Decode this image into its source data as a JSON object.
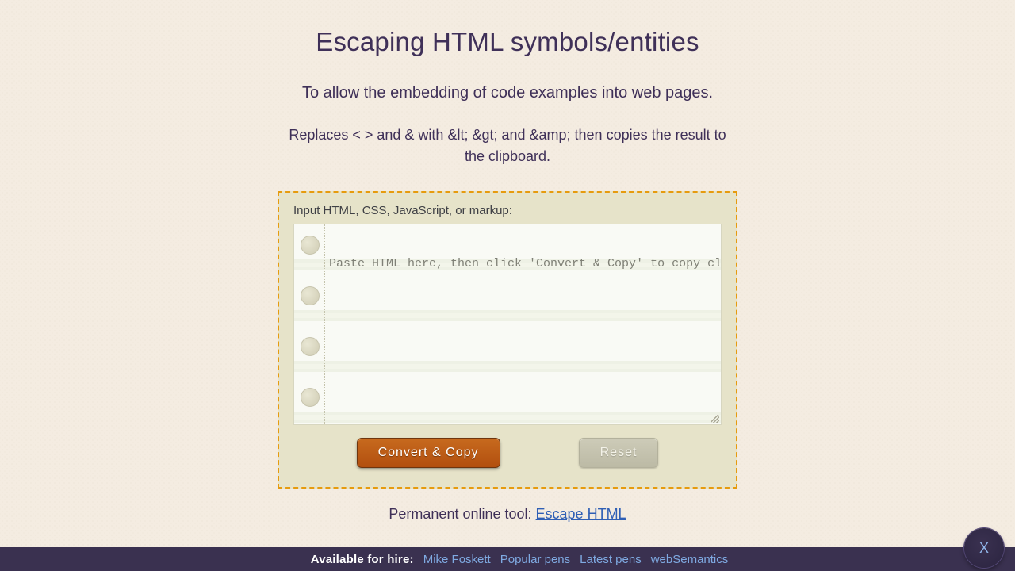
{
  "title": "Escaping HTML symbols/entities",
  "tagline": "To allow the embedding of code examples into web pages.",
  "explain": "Replaces < > and & with &lt; &gt; and &amp; then copies the result to the clipboard.",
  "form": {
    "label": "Input HTML, CSS, JavaScript, or markup:",
    "placeholder": "Paste HTML here, then click 'Convert & Copy' to copy cleaned code to the clipboard ...",
    "value": "",
    "convert_label": "Convert & Copy",
    "reset_label": "Reset"
  },
  "permalink": {
    "prefix": "Permanent online tool: ",
    "link_text": "Escape HTML"
  },
  "footer": {
    "lead": "Available for hire:",
    "links": [
      "Mike Foskett",
      "Popular pens",
      "Latest pens",
      "webSemantics"
    ],
    "close_label": "X"
  }
}
